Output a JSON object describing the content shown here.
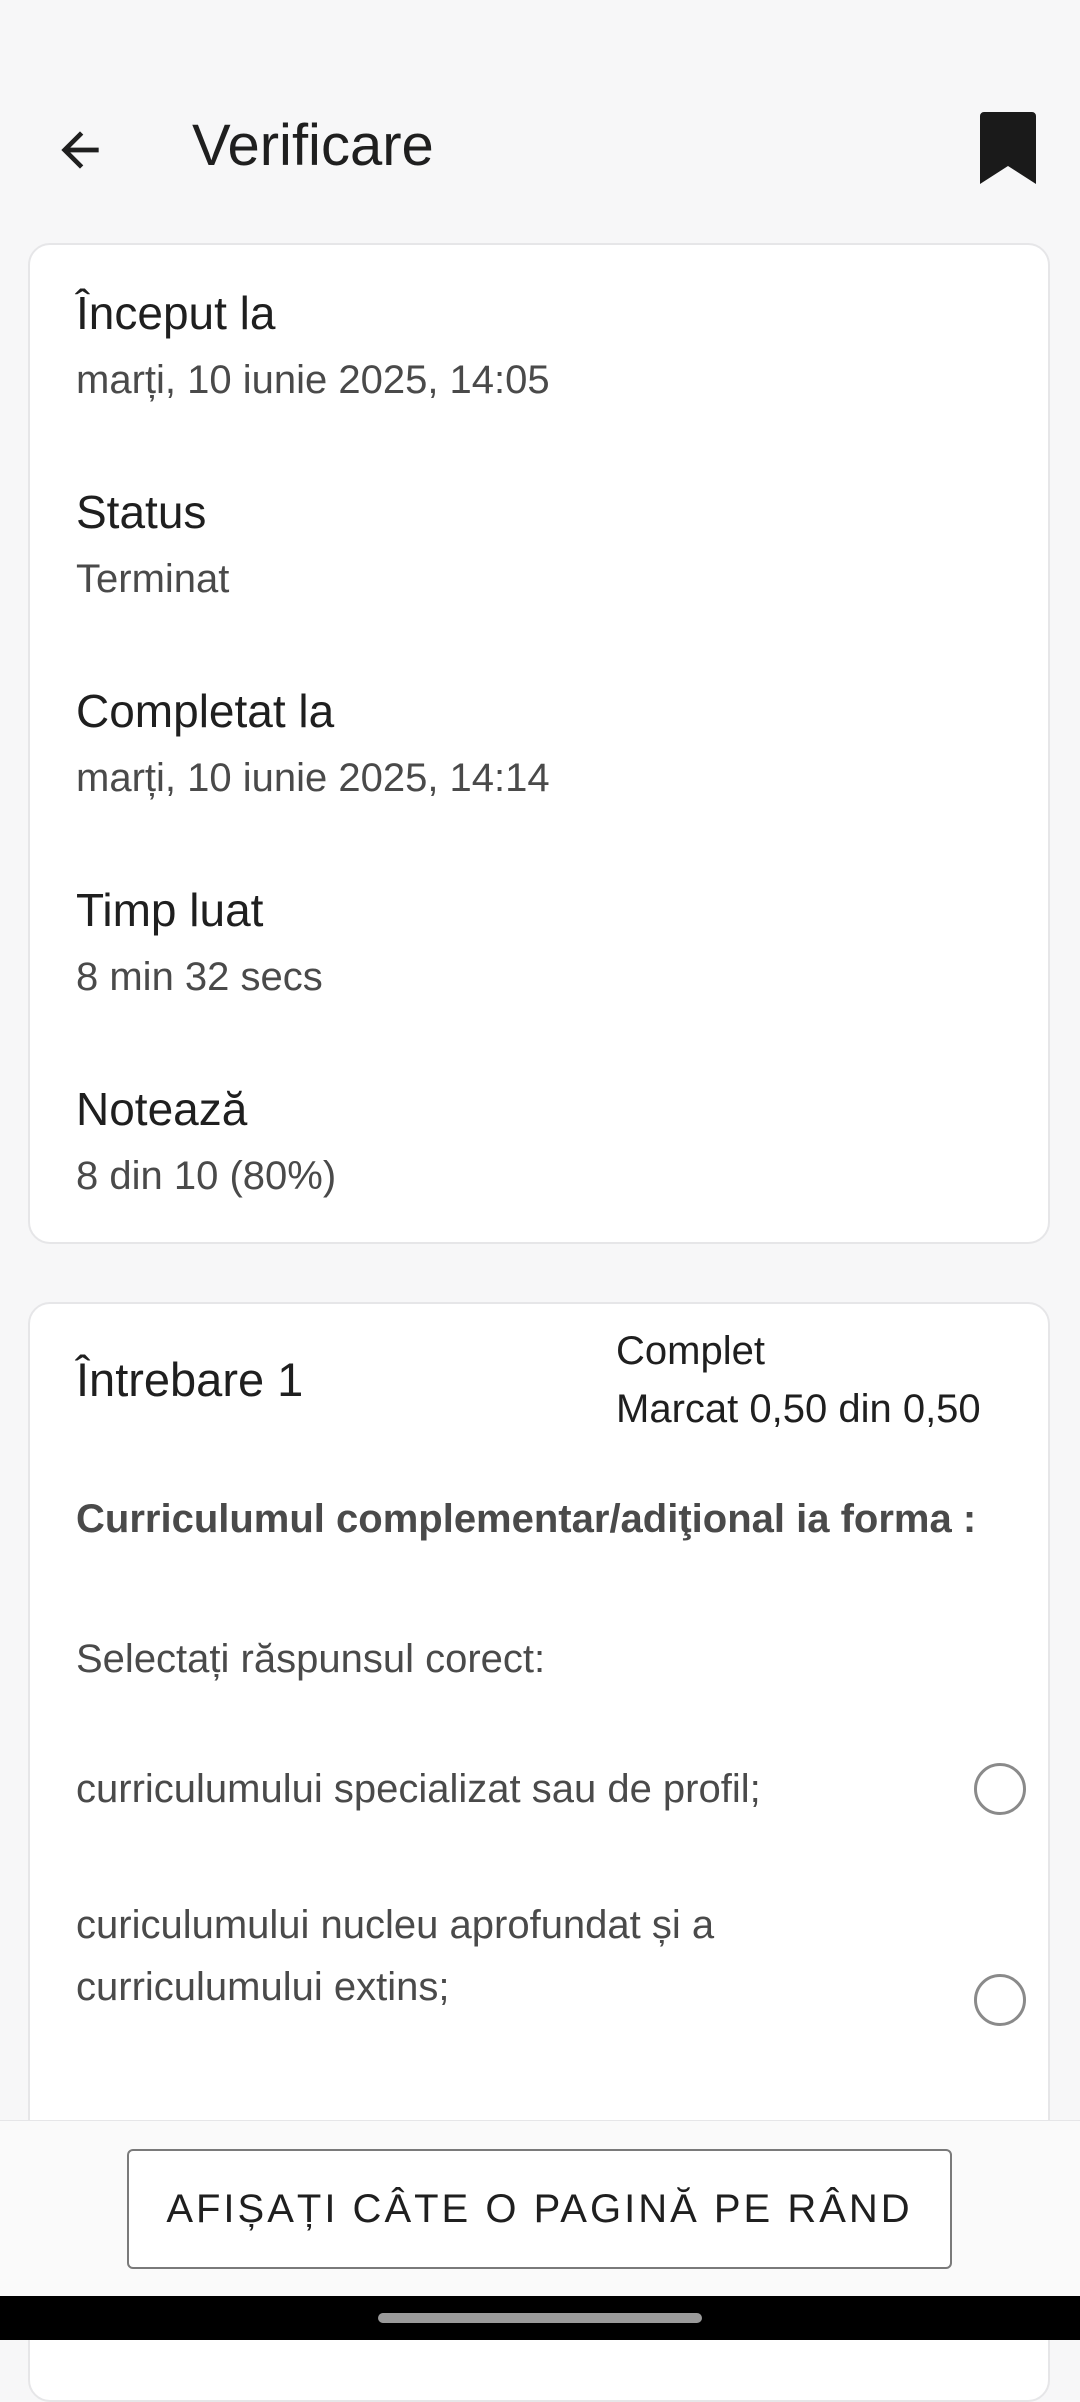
{
  "header": {
    "title": "Verificare",
    "back_icon": "arrow-left-icon",
    "bookmark_icon": "bookmark-icon"
  },
  "summary": {
    "started": {
      "label": "Început la",
      "value": "marți, 10 iunie 2025, 14:05"
    },
    "status": {
      "label": "Status",
      "value": "Terminat"
    },
    "completed": {
      "label": "Completat la",
      "value": "marți, 10 iunie 2025, 14:14"
    },
    "time_taken": {
      "label": "Timp luat",
      "value": "8 min 32 secs"
    },
    "grade": {
      "label": "Notează",
      "value": "8 din 10 (80%)"
    }
  },
  "question": {
    "title": "Întrebare 1",
    "state": "Complet",
    "mark": "Marcat 0,50 din 0,50",
    "text": "Curriculumul complementar/adiţional ia forma :",
    "instruction": "Selectați răspunsul corect:",
    "options": [
      {
        "label": "curriculumului  specializat sau de profil;"
      },
      {
        "label": "curiculumului nucleu aprofundat și a curriculumului extins;"
      }
    ]
  },
  "footer": {
    "page_button": "AFIȘAȚI CÂTE O PAGINĂ PE RÂND"
  }
}
